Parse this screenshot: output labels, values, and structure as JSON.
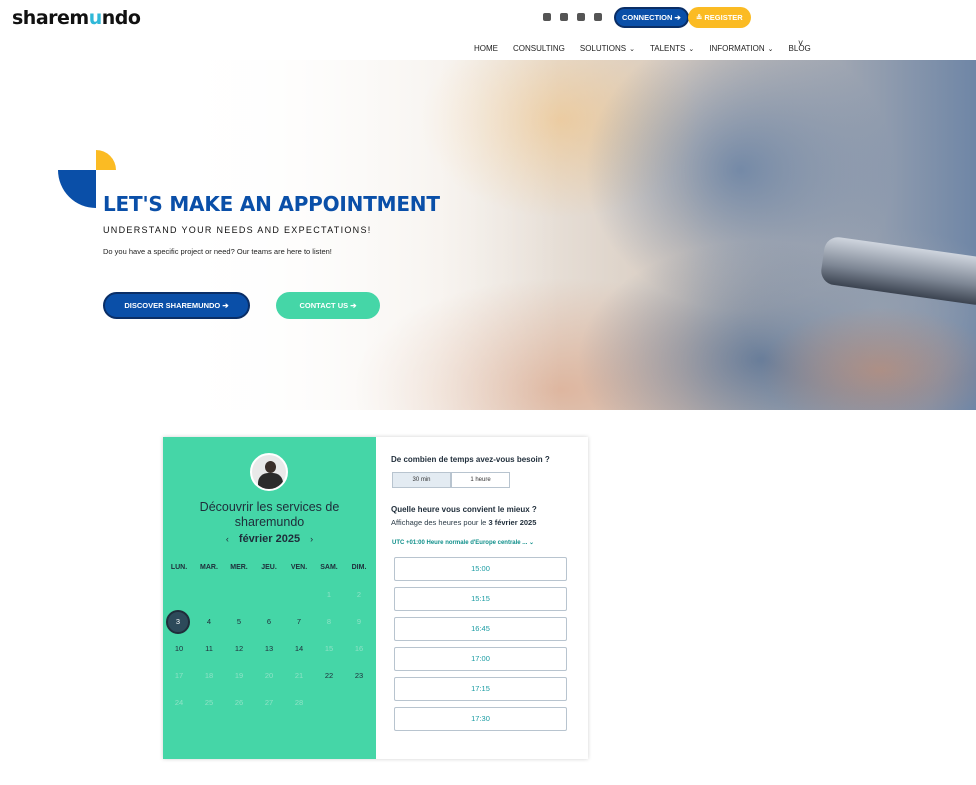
{
  "header": {
    "logo_prefix": "sharem",
    "logo_accent": "u",
    "logo_suffix": "ndo",
    "connection_label": "CONNECTION ➔",
    "register_label": "≗ REGISTER",
    "social_icons": [
      "linkedin-icon",
      "twitter-icon",
      "youtube-icon",
      "email-icon"
    ],
    "nav": [
      {
        "label": "HOME",
        "dropdown": false
      },
      {
        "label": "CONSULTING",
        "dropdown": false
      },
      {
        "label": "SOLUTIONS",
        "dropdown": true
      },
      {
        "label": "TALENTS",
        "dropdown": true
      },
      {
        "label": "INFORMATION",
        "dropdown": true
      },
      {
        "label": "BLOG",
        "dropdown": false
      }
    ],
    "nav_more": "˅"
  },
  "hero": {
    "title": "LET'S MAKE AN APPOINTMENT",
    "subtitle": "UNDERSTAND YOUR NEEDS AND EXPECTATIONS!",
    "text": "Do you have a specific project or need? Our teams are here to listen!",
    "discover_label": "DISCOVER SHAREMUNDO ➔",
    "contact_label": "CONTACT US ➔"
  },
  "calendar": {
    "title_line1": "Découvrir les services de",
    "title_line2": "sharemundo",
    "month": "février 2025",
    "prev": "‹",
    "next": "›",
    "weekdays": [
      "LUN.",
      "MAR.",
      "MER.",
      "JEU.",
      "VEN.",
      "SAM.",
      "DIM."
    ],
    "selected_day": "3",
    "weeks": [
      [
        {
          "d": "",
          "a": false
        },
        {
          "d": "",
          "a": false
        },
        {
          "d": "",
          "a": false
        },
        {
          "d": "",
          "a": false
        },
        {
          "d": "",
          "a": false
        },
        {
          "d": "1",
          "a": false
        },
        {
          "d": "2",
          "a": false
        }
      ],
      [
        {
          "d": "3",
          "a": true
        },
        {
          "d": "4",
          "a": true
        },
        {
          "d": "5",
          "a": true
        },
        {
          "d": "6",
          "a": true
        },
        {
          "d": "7",
          "a": true
        },
        {
          "d": "8",
          "a": false
        },
        {
          "d": "9",
          "a": false
        }
      ],
      [
        {
          "d": "10",
          "a": true
        },
        {
          "d": "11",
          "a": true
        },
        {
          "d": "12",
          "a": true
        },
        {
          "d": "13",
          "a": true
        },
        {
          "d": "14",
          "a": true
        },
        {
          "d": "15",
          "a": false
        },
        {
          "d": "16",
          "a": false
        }
      ],
      [
        {
          "d": "17",
          "a": false
        },
        {
          "d": "18",
          "a": false
        },
        {
          "d": "19",
          "a": false
        },
        {
          "d": "20",
          "a": false
        },
        {
          "d": "21",
          "a": false
        },
        {
          "d": "22",
          "a": true
        },
        {
          "d": "23",
          "a": true
        }
      ],
      [
        {
          "d": "24",
          "a": false
        },
        {
          "d": "25",
          "a": false
        },
        {
          "d": "26",
          "a": false
        },
        {
          "d": "27",
          "a": false
        },
        {
          "d": "28",
          "a": false
        },
        {
          "d": "",
          "a": false
        },
        {
          "d": "",
          "a": false
        }
      ]
    ]
  },
  "booking": {
    "duration_question": "De combien de temps avez-vous besoin ?",
    "duration_options": [
      "30 min",
      "1 heure"
    ],
    "time_question": "Quelle heure vous convient le mieux ?",
    "showing_prefix": "Affichage des heures pour le ",
    "showing_date": "3 février 2025",
    "timezone": "UTC +01:00 Heure normale d'Europe centrale ... ⌄",
    "slots": [
      "15:00",
      "15:15",
      "16:45",
      "17:00",
      "17:15",
      "17:30"
    ]
  },
  "colors": {
    "brand_blue": "#0a4fa8",
    "brand_yellow": "#fbbb23",
    "brand_green": "#45d6a7"
  }
}
